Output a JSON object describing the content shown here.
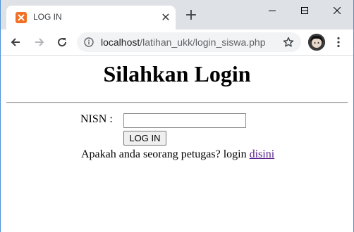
{
  "browser": {
    "tab_title": "LOG IN",
    "url_host": "localhost",
    "url_path": "/latihan_ukk/login_siswa.php",
    "new_tab_symbol": "+",
    "tab_close_symbol": "✕",
    "icons": [
      "xampp-favicon-icon",
      "back-arrow-icon",
      "forward-arrow-icon",
      "reload-icon",
      "info-icon",
      "star-icon",
      "profile-avatar",
      "menu-dots-icon",
      "minimize-icon",
      "maximize-icon",
      "close-window-icon"
    ]
  },
  "page": {
    "heading": "Silahkan Login",
    "nisn_label": "NISN :",
    "nisn_value": "",
    "login_button": "LOG IN",
    "prompt_text": "Apakah anda seorang petugas? login ",
    "link_text": "disini"
  },
  "colors": {
    "titlebar": "#dee1e6",
    "favicon": "#f46f25",
    "visited_link": "#551a8b"
  }
}
